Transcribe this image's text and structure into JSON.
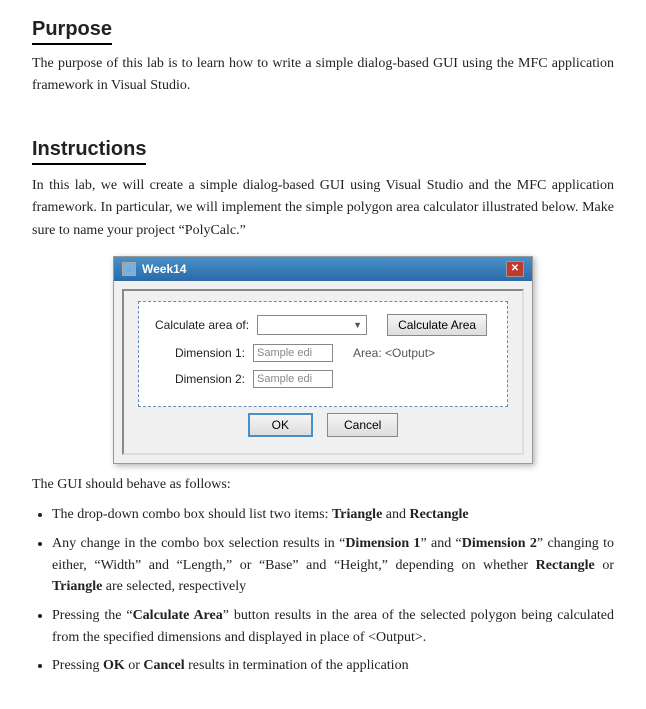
{
  "purpose": {
    "title": "Purpose",
    "text": "The purpose of this lab is to learn how to write a simple dialog-based GUI using the MFC application framework in Visual Studio."
  },
  "instructions": {
    "title": "Instructions",
    "intro": "In this lab, we will create a simple dialog-based GUI using Visual Studio and the MFC application framework. In particular, we will implement the simple polygon area calculator illustrated below. Make sure to name your project “PolyCalc.”",
    "dialog": {
      "title": "Week14",
      "close_label": "✕",
      "calculate_area_of_label": "Calculate area of:",
      "combo_placeholder": "",
      "calculate_area_btn": "Calculate Area",
      "dimension1_label": "Dimension 1:",
      "dimension1_input": "Sample edi",
      "area_label": "Area: <Output>",
      "dimension2_label": "Dimension 2:",
      "dimension2_input": "Sample edi",
      "ok_btn": "OK",
      "cancel_btn": "Cancel"
    },
    "gui_intro": "The GUI should behave as follows:",
    "bullets": [
      {
        "text_parts": [
          {
            "text": "The drop-down combo box should list two items: ",
            "bold": false
          },
          {
            "text": "Triangle",
            "bold": true
          },
          {
            "text": " and ",
            "bold": false
          },
          {
            "text": "Rectangle",
            "bold": true
          }
        ]
      },
      {
        "text_parts": [
          {
            "text": "Any change in the combo box selection results in “",
            "bold": false
          },
          {
            "text": "Dimension 1",
            "bold": true
          },
          {
            "text": "” and “",
            "bold": false
          },
          {
            "text": "Dimension 2",
            "bold": true
          },
          {
            "text": "” changing to either, “Width” and “Length,” or “Base” and “Height,” depending on whether ",
            "bold": false
          },
          {
            "text": "Rectangle",
            "bold": true
          },
          {
            "text": " or ",
            "bold": false
          },
          {
            "text": "Triangle",
            "bold": true
          },
          {
            "text": " are selected, respectively",
            "bold": false
          }
        ]
      },
      {
        "text_parts": [
          {
            "text": "Pressing the “",
            "bold": false
          },
          {
            "text": "Calculate Area",
            "bold": true
          },
          {
            "text": "” button results in the area of the selected polygon being calculated from the specified dimensions and displayed in place of <Output>.",
            "bold": false
          }
        ]
      },
      {
        "text_parts": [
          {
            "text": "Pressing ",
            "bold": false
          },
          {
            "text": "OK",
            "bold": true
          },
          {
            "text": " or ",
            "bold": false
          },
          {
            "text": "Cancel",
            "bold": true
          },
          {
            "text": " results in termination of the application",
            "bold": false
          }
        ]
      }
    ]
  }
}
